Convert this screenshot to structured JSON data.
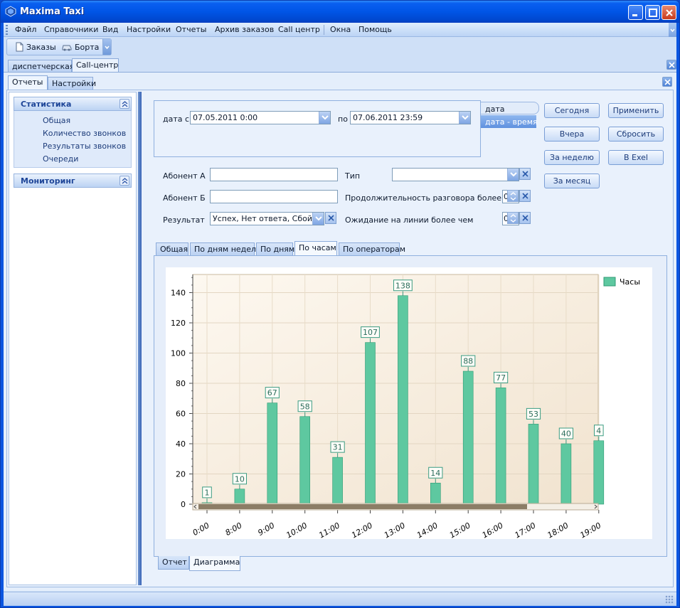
{
  "window": {
    "title": "Maxima Taxi"
  },
  "menu": [
    "Файл",
    "Справочники",
    "Вид",
    "Настройки",
    "Отчеты",
    "Архив заказов",
    "Call центр",
    "Окна",
    "Помощь"
  ],
  "toolbar": {
    "orders": "Заказы",
    "cars": "Борта"
  },
  "doc_tabs": [
    "диспетчерская",
    "Call-центр"
  ],
  "sub_tabs": [
    "Отчеты",
    "Настройки"
  ],
  "nav": {
    "groups": [
      {
        "title": "Статистика",
        "items": [
          "Общая",
          "Количество звонков",
          "Результаты звонков",
          "Очереди"
        ]
      },
      {
        "title": "Мониторинг",
        "items": []
      }
    ]
  },
  "filters": {
    "date_from_label": "дата с",
    "date_from": "07.05.2011 0:00",
    "date_to_label": "по",
    "date_to": "07.06.2011 23:59",
    "mode_options": [
      "дата",
      "дата - время"
    ],
    "subscriber_a_label": "Абонент А",
    "subscriber_b_label": "Абонент Б",
    "result_label": "Результат",
    "result_value": "Успех, Нет ответа, Сбой…",
    "type_label": "Тип",
    "duration_label": "Продолжительность разговора более чем",
    "duration_value": "0",
    "waiting_label": "Ожидание на линии более чем",
    "waiting_value": "0"
  },
  "buttons": {
    "today": "Сегодня",
    "yesterday": "Вчера",
    "week": "За неделю",
    "month": "За месяц",
    "apply": "Применить",
    "reset": "Сбросить",
    "excel": "В Exel"
  },
  "view_tabs": [
    "Общая",
    "По дням недели",
    "По дням",
    "По часам",
    "По операторам"
  ],
  "bottom_tabs": [
    "Отчет",
    "Диаграмма"
  ],
  "chart_data": {
    "type": "bar",
    "categories": [
      "0:00",
      "8:00",
      "9:00",
      "10:00",
      "11:00",
      "12:00",
      "13:00",
      "14:00",
      "15:00",
      "16:00",
      "17:00",
      "18:00",
      "19:00"
    ],
    "series": [
      {
        "name": "Часы",
        "values": [
          1,
          10,
          67,
          58,
          31,
          107,
          138,
          14,
          88,
          77,
          53,
          40,
          42
        ],
        "color": "#5ec8a0"
      }
    ],
    "labels": [
      "1",
      "10",
      "67",
      "58",
      "31",
      "107",
      "138",
      "14",
      "88",
      "77",
      "53",
      "40",
      "4"
    ],
    "ylim": [
      0,
      152
    ],
    "yticks": [
      0,
      20,
      40,
      60,
      80,
      100,
      120,
      140
    ],
    "grid": true,
    "legend": "top-right",
    "plot_bg": [
      "#fdf8f0",
      "#f1e3cf"
    ]
  }
}
